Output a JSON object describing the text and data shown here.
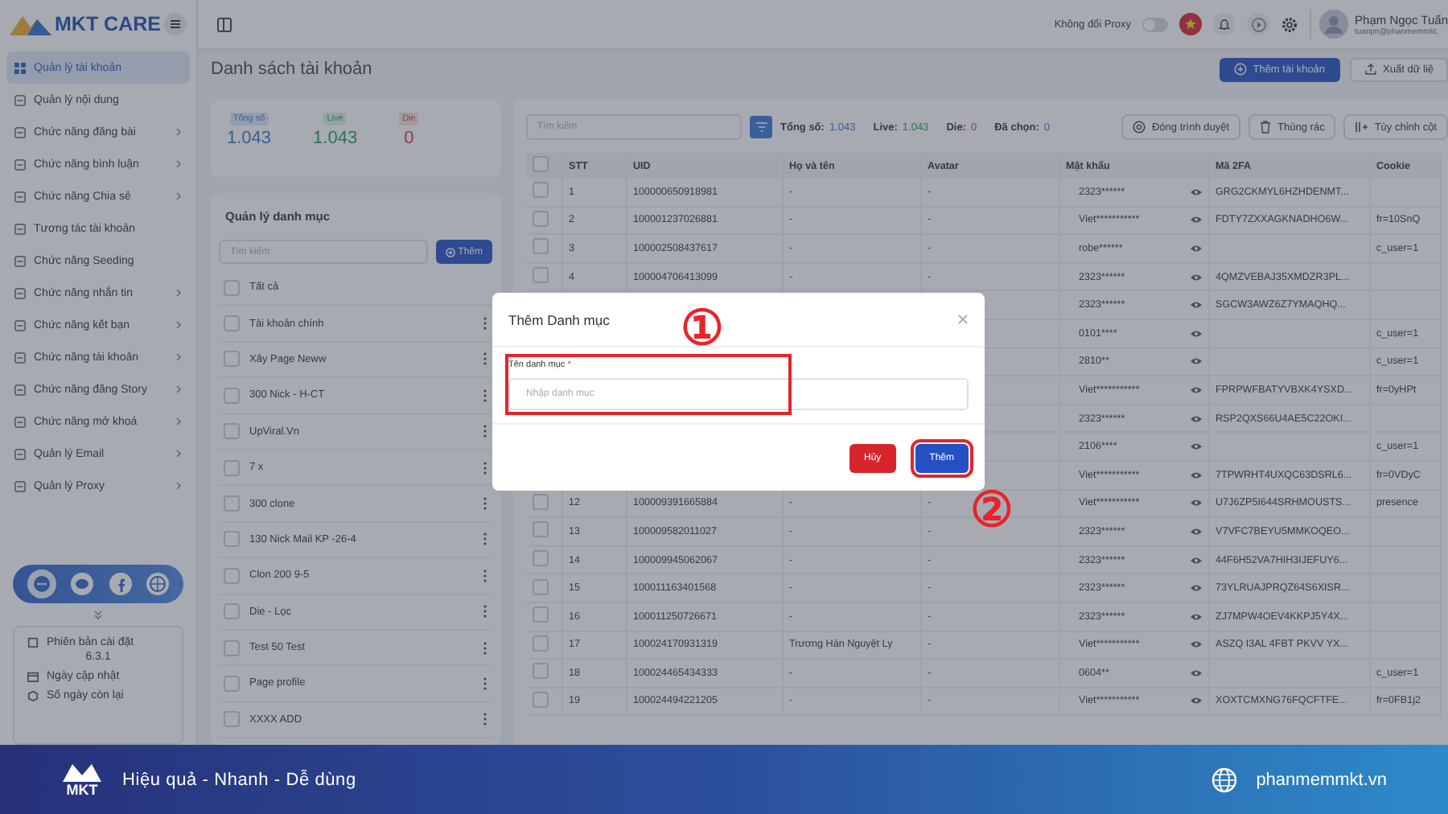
{
  "sidebar": {
    "logo": "MKT CARE",
    "items": [
      {
        "label": "Quản lý tài khoản",
        "selected": true,
        "has_submenu": false
      },
      {
        "label": "Quản lý nội dung",
        "selected": false,
        "has_submenu": false
      },
      {
        "label": "Chức năng đăng bài",
        "selected": false,
        "has_submenu": true
      },
      {
        "label": "Chức năng bình luận",
        "selected": false,
        "has_submenu": true
      },
      {
        "label": "Chức năng Chia sẻ",
        "selected": false,
        "has_submenu": true
      },
      {
        "label": "Tương tác tài khoản",
        "selected": false,
        "has_submenu": false
      },
      {
        "label": "Chức năng Seeding",
        "selected": false,
        "has_submenu": false
      },
      {
        "label": "Chức năng nhắn tin",
        "selected": false,
        "has_submenu": true
      },
      {
        "label": "Chức năng kết bạn",
        "selected": false,
        "has_submenu": true
      },
      {
        "label": "Chức năng tài khoản",
        "selected": false,
        "has_submenu": true
      },
      {
        "label": "Chức năng đăng Story",
        "selected": false,
        "has_submenu": true
      },
      {
        "label": "Chức năng mở khoá",
        "selected": false,
        "has_submenu": true
      },
      {
        "label": "Quản lý Email",
        "selected": false,
        "has_submenu": true
      },
      {
        "label": "Quản lý Proxy",
        "selected": false,
        "has_submenu": true
      }
    ],
    "info": {
      "version_label": "Phiên bản cài đặt",
      "version": "6.3.1",
      "updated_label": "Ngày cập nhật",
      "days_left_label": "Số ngày còn lại"
    }
  },
  "header": {
    "proxy_label": "Không đổi Proxy",
    "proxy_on": false,
    "user_name": "Phạm Ngọc Tuấn",
    "user_email": "tuanpn@phanmemmkt."
  },
  "page": {
    "title": "Danh sách tài khoản",
    "buttons": [
      {
        "label": "Thêm tài khoản",
        "kind": "primary"
      },
      {
        "label": "Xuất dữ liệ",
        "kind": "outline"
      }
    ]
  },
  "stats": [
    {
      "label": "Tổng số",
      "value": "1.043",
      "kind": "total"
    },
    {
      "label": "Live",
      "value": "1.043",
      "kind": "live"
    },
    {
      "label": "Die",
      "value": "0",
      "kind": "die"
    }
  ],
  "categories": {
    "title": "Quản lý danh mục",
    "search_placeholder": "Tìm kiếm",
    "add_button": "Thêm",
    "items": [
      {
        "label": "Tất cả",
        "kind": "all",
        "checked": false
      },
      {
        "label": "Tài khoản chính",
        "kind": "item",
        "checked": false
      },
      {
        "label": "Xây Page Neww",
        "kind": "item",
        "checked": false
      },
      {
        "label": "300 Nick - H-CT",
        "kind": "item",
        "checked": false
      },
      {
        "label": "UpViral.Vn",
        "kind": "item",
        "checked": false
      },
      {
        "label": "7 x",
        "kind": "item",
        "checked": false
      },
      {
        "label": "300 clone",
        "kind": "item",
        "checked": false
      },
      {
        "label": "130 Nick Mail KP -26-4",
        "kind": "item",
        "checked": false
      },
      {
        "label": "Clon 200 9-5",
        "kind": "item",
        "checked": false
      },
      {
        "label": "Die - Lọc",
        "kind": "item",
        "checked": false
      },
      {
        "label": "Test 50 Test",
        "kind": "item",
        "checked": false
      },
      {
        "label": "Page profile",
        "kind": "item",
        "checked": false
      },
      {
        "label": "XXXX ADD",
        "kind": "item",
        "checked": false
      }
    ]
  },
  "toolbar": {
    "search_placeholder": "Tìm kiếm",
    "counts": [
      {
        "label": "Tổng số:",
        "value": "1.043",
        "kind": "total"
      },
      {
        "label": "Live:",
        "value": "1.043",
        "kind": "live"
      },
      {
        "label": "Die:",
        "value": "0",
        "kind": "die"
      },
      {
        "label": "Đã chọn:",
        "value": "0",
        "kind": "selected"
      }
    ],
    "buttons": [
      {
        "label": "Đóng trình duyệt",
        "kind": "browser"
      },
      {
        "label": "Thùng rác",
        "kind": "trash"
      },
      {
        "label": "Tùy chỉnh cột",
        "kind": "columns"
      }
    ]
  },
  "table": {
    "all_checked": false,
    "columns": [
      "STT",
      "UID",
      "Họ và tên",
      "Avatar",
      "Mật khẩu",
      "Mã 2FA",
      "Cookie"
    ],
    "rows": [
      {
        "stt": "1",
        "uid": "100000650918981",
        "name": "-",
        "avatar": "-",
        "password": "2323******",
        "twofa": "GRG2CKMYL6HZHDENMT...",
        "cookie": "",
        "checked": false
      },
      {
        "stt": "2",
        "uid": "100001237026881",
        "name": "-",
        "avatar": "-",
        "password": "Viet***********",
        "twofa": "FDTY7ZXXAGKNADHO6W...",
        "cookie": "fr=10SnQ",
        "checked": false
      },
      {
        "stt": "3",
        "uid": "100002508437617",
        "name": "-",
        "avatar": "-",
        "password": "robe******",
        "twofa": "",
        "cookie": "c_user=1",
        "checked": false
      },
      {
        "stt": "4",
        "uid": "100004706413099",
        "name": "-",
        "avatar": "-",
        "password": "2323******",
        "twofa": "4QMZVEBAJ35XMDZR3PL...",
        "cookie": "",
        "checked": false
      },
      {
        "password": "2323******",
        "twofa": "SGCW3AWZ6Z7YMAQHQ...",
        "cookie": ""
      },
      {
        "password": "0101****",
        "twofa": "",
        "cookie": "c_user=1"
      },
      {
        "password": "2810**",
        "twofa": "",
        "cookie": "c_user=1"
      },
      {
        "password": "Viet***********",
        "twofa": "FPRPWFBATYVBXK4YSXD...",
        "cookie": "fr=0yHPt"
      },
      {
        "password": "2323******",
        "twofa": "RSP2QXS66U4AE5C22OKI...",
        "cookie": ""
      },
      {
        "password": "2106****",
        "twofa": "",
        "cookie": "c_user=1"
      },
      {
        "password": "Viet***********",
        "twofa": "7TPWRHT4UXQC63DSRL6...",
        "cookie": "fr=0VDyC"
      },
      {
        "stt": "12",
        "uid": "100009391665884",
        "name": "-",
        "avatar": "-",
        "password": "Viet***********",
        "twofa": "U7J6ZP5I644SRHMOUSTS...",
        "cookie": "presence",
        "checked": false
      },
      {
        "stt": "13",
        "uid": "100009582011027",
        "name": "-",
        "avatar": "-",
        "password": "2323******",
        "twofa": "V7VFC7BEYU5MMKOQEO...",
        "cookie": "",
        "checked": false
      },
      {
        "stt": "14",
        "uid": "100009945062067",
        "name": "-",
        "avatar": "-",
        "password": "2323******",
        "twofa": "44F6H52VA7HIH3IJEFUY6...",
        "cookie": "",
        "checked": false
      },
      {
        "stt": "15",
        "uid": "100011163401568",
        "name": "-",
        "avatar": "-",
        "password": "2323******",
        "twofa": "73YLRUAJPRQZ64S6XISR...",
        "cookie": "",
        "checked": false
      },
      {
        "stt": "16",
        "uid": "100011250726671",
        "name": "-",
        "avatar": "-",
        "password": "2323******",
        "twofa": "ZJ7MPW4OEV4KKPJ5Y4X...",
        "cookie": "",
        "checked": false
      },
      {
        "stt": "17",
        "uid": "100024170931319",
        "name": "Trương Hàn Nguyệt Ly",
        "avatar": "-",
        "password": "Viet***********",
        "twofa": "ASZQ I3AL 4FBT PKVV YX...",
        "cookie": "",
        "checked": false
      },
      {
        "stt": "18",
        "uid": "100024465434333",
        "name": "-",
        "avatar": "-",
        "password": "0604**",
        "twofa": "",
        "cookie": "c_user=1",
        "checked": false
      },
      {
        "stt": "19",
        "uid": "100024494221205",
        "name": "-",
        "avatar": "-",
        "password": "Viet***********",
        "twofa": "XOXTCMXNG76FQCFTFE...",
        "cookie": "fr=0FB1j2",
        "checked": false
      }
    ]
  },
  "dialog": {
    "title": "Thêm Danh mục",
    "field_label": "Tên danh mục",
    "required_mark": "*",
    "placeholder": "Nhập danh mục",
    "buttons": [
      {
        "label": "Hủy",
        "kind": "cancel"
      },
      {
        "label": "Thêm",
        "kind": "primary"
      }
    ]
  },
  "annotations": [
    {
      "label": "①"
    },
    {
      "label": "②"
    }
  ],
  "banner": {
    "logo": "MKT",
    "slogan": "Hiệu quả - Nhanh - Dễ dùng",
    "website": "phanmemmkt.vn"
  }
}
